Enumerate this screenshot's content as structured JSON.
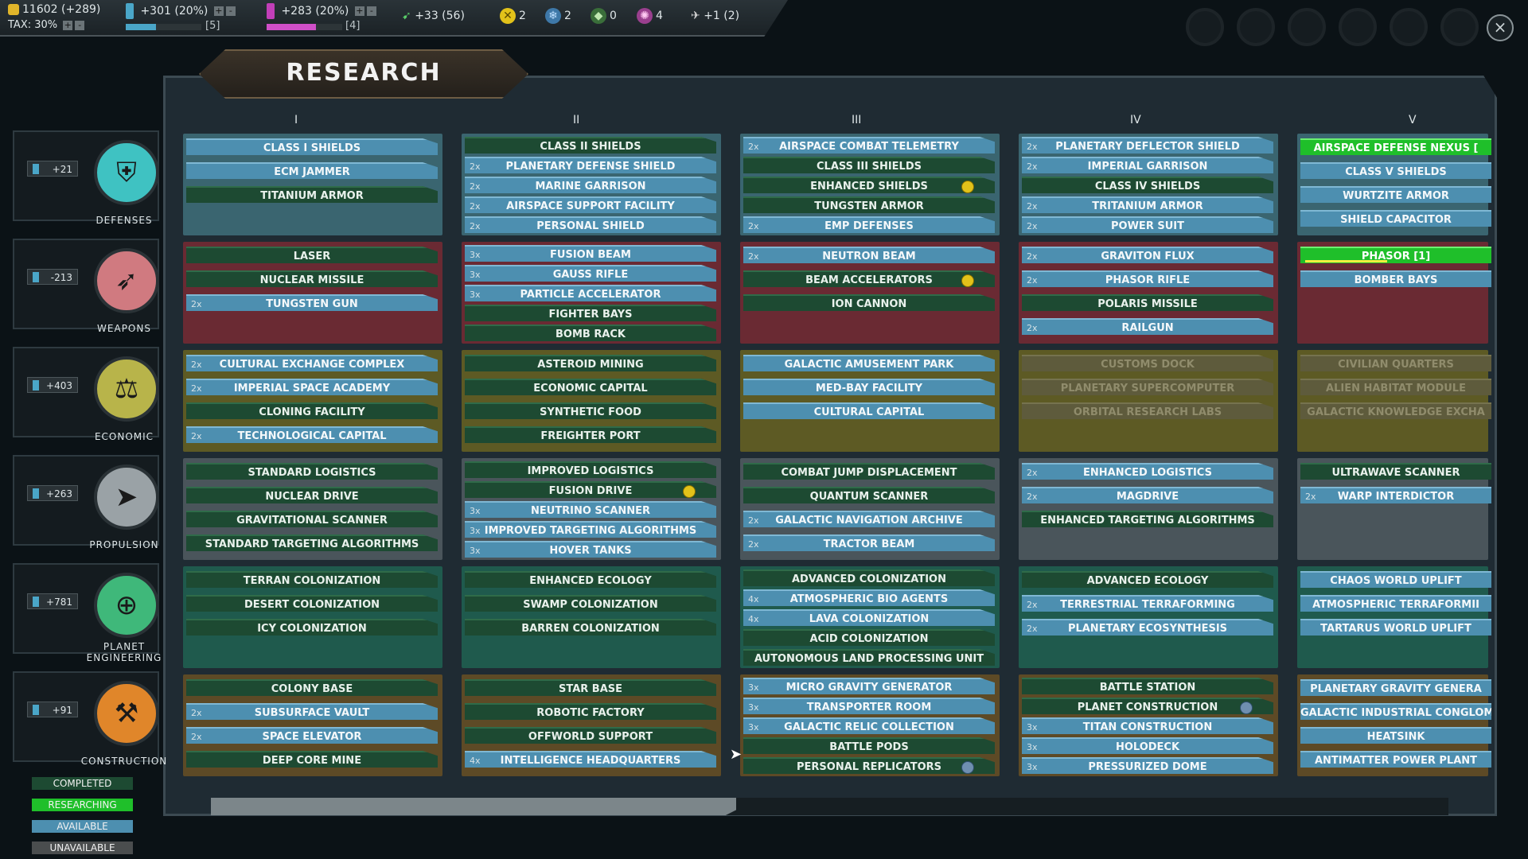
{
  "topbar": {
    "credits": "11602 (+289)",
    "tax": "TAX: 30%",
    "research": "+301 (20%)",
    "research_sub": "[5]",
    "research_fill": 0.4,
    "influence": "+283 (20%)",
    "influence_sub": "[4]",
    "influence_fill": 0.65,
    "ships": "+33 (56)",
    "res_gold": "2",
    "res_blue": "2",
    "res_green": "0",
    "res_pink": "4",
    "cargo": "+1 (2)"
  },
  "title": "RESEARCH",
  "columns": [
    "I",
    "II",
    "III",
    "IV",
    "V"
  ],
  "categories": [
    {
      "label": "DEFENSES",
      "value": "+21",
      "icon": "shield-icon",
      "color": "#3fc2c2"
    },
    {
      "label": "WEAPONS",
      "value": "-213",
      "icon": "missiles-icon",
      "color": "#d07a80"
    },
    {
      "label": "ECONOMIC",
      "value": "+403",
      "icon": "economy-icon",
      "color": "#b8b44a"
    },
    {
      "label": "PROPULSION",
      "value": "+263",
      "icon": "rocket-icon",
      "color": "#9aa2a6"
    },
    {
      "label": "PLANET",
      "label2": "ENGINEERING",
      "value": "+781",
      "icon": "globe-hands-icon",
      "color": "#3fb87a"
    },
    {
      "label": "CONSTRUCTION",
      "value": "+91",
      "icon": "crane-icon",
      "color": "#e0862a"
    }
  ],
  "grid": [
    [
      [
        {
          "n": "CLASS I SHIELDS",
          "s": "available"
        },
        {
          "n": "ECM JAMMER",
          "s": "available"
        },
        {
          "n": "TITANIUM ARMOR",
          "s": "completed"
        }
      ],
      [
        {
          "n": "CLASS II SHIELDS",
          "s": "completed"
        },
        {
          "n": "PLANETARY DEFENSE SHIELD",
          "s": "available",
          "m": "2x"
        },
        {
          "n": "MARINE GARRISON",
          "s": "available",
          "m": "2x"
        },
        {
          "n": "AIRSPACE SUPPORT FACILITY",
          "s": "available",
          "m": "2x"
        },
        {
          "n": "PERSONAL SHIELD",
          "s": "available",
          "m": "2x"
        }
      ],
      [
        {
          "n": "AIRSPACE COMBAT TELEMETRY",
          "s": "available",
          "m": "2x"
        },
        {
          "n": "CLASS III SHIELDS",
          "s": "completed"
        },
        {
          "n": "ENHANCED SHIELDS",
          "s": "completed",
          "b": "gold"
        },
        {
          "n": "TUNGSTEN ARMOR",
          "s": "completed"
        },
        {
          "n": "EMP DEFENSES",
          "s": "available",
          "m": "2x"
        }
      ],
      [
        {
          "n": "PLANETARY DEFLECTOR SHIELD",
          "s": "available",
          "m": "2x"
        },
        {
          "n": "IMPERIAL GARRISON",
          "s": "available",
          "m": "2x"
        },
        {
          "n": "CLASS IV SHIELDS",
          "s": "completed"
        },
        {
          "n": "TRITANIUM ARMOR",
          "s": "available",
          "m": "2x"
        },
        {
          "n": "POWER SUIT",
          "s": "available",
          "m": "2x"
        }
      ],
      [
        {
          "n": "AIRSPACE DEFENSE NEXUS [",
          "s": "researching"
        },
        {
          "n": "CLASS V SHIELDS",
          "s": "available"
        },
        {
          "n": "WURTZITE ARMOR",
          "s": "available"
        },
        {
          "n": "SHIELD CAPACITOR",
          "s": "available"
        }
      ]
    ],
    [
      [
        {
          "n": "LASER",
          "s": "completed"
        },
        {
          "n": "NUCLEAR MISSILE",
          "s": "completed"
        },
        {
          "n": "TUNGSTEN GUN",
          "s": "available",
          "m": "2x"
        }
      ],
      [
        {
          "n": "FUSION BEAM",
          "s": "available",
          "m": "3x"
        },
        {
          "n": "GAUSS RIFLE",
          "s": "available",
          "m": "3x"
        },
        {
          "n": "PARTICLE ACCELERATOR",
          "s": "available",
          "m": "3x"
        },
        {
          "n": "FIGHTER BAYS",
          "s": "completed"
        },
        {
          "n": "BOMB RACK",
          "s": "completed"
        }
      ],
      [
        {
          "n": "NEUTRON BEAM",
          "s": "available",
          "m": "2x"
        },
        {
          "n": "BEAM ACCELERATORS",
          "s": "completed",
          "b": "gold"
        },
        {
          "n": "ION CANNON",
          "s": "completed"
        }
      ],
      [
        {
          "n": "GRAVITON FLUX",
          "s": "available",
          "m": "2x"
        },
        {
          "n": "PHASOR RIFLE",
          "s": "available",
          "m": "2x"
        },
        {
          "n": "POLARIS MISSILE",
          "s": "completed"
        },
        {
          "n": "RAILGUN",
          "s": "available",
          "m": "2x"
        }
      ],
      [
        {
          "n": "PHASOR [1]",
          "s": "researching",
          "p": 0.45
        },
        {
          "n": "BOMBER BAYS",
          "s": "available"
        }
      ]
    ],
    [
      [
        {
          "n": "CULTURAL EXCHANGE COMPLEX",
          "s": "available",
          "m": "2x"
        },
        {
          "n": "IMPERIAL SPACE ACADEMY",
          "s": "available",
          "m": "2x"
        },
        {
          "n": "CLONING FACILITY",
          "s": "completed"
        },
        {
          "n": "TECHNOLOGICAL CAPITAL",
          "s": "available",
          "m": "2x"
        }
      ],
      [
        {
          "n": "ASTEROID MINING",
          "s": "completed"
        },
        {
          "n": "ECONOMIC CAPITAL",
          "s": "completed"
        },
        {
          "n": "SYNTHETIC FOOD",
          "s": "completed"
        },
        {
          "n": "FREIGHTER PORT",
          "s": "completed"
        }
      ],
      [
        {
          "n": "GALACTIC AMUSEMENT PARK",
          "s": "available"
        },
        {
          "n": "MED-BAY FACILITY",
          "s": "available"
        },
        {
          "n": "CULTURAL CAPITAL",
          "s": "available"
        }
      ],
      [
        {
          "n": "CUSTOMS DOCK",
          "s": "unavailable"
        },
        {
          "n": "PLANETARY SUPERCOMPUTER",
          "s": "unavailable"
        },
        {
          "n": "ORBITAL RESEARCH LABS",
          "s": "unavailable"
        }
      ],
      [
        {
          "n": "CIVILIAN QUARTERS",
          "s": "unavailable"
        },
        {
          "n": "ALIEN HABITAT MODULE",
          "s": "unavailable"
        },
        {
          "n": "GALACTIC KNOWLEDGE EXCHA",
          "s": "unavailable"
        }
      ]
    ],
    [
      [
        {
          "n": "STANDARD LOGISTICS",
          "s": "completed"
        },
        {
          "n": "NUCLEAR DRIVE",
          "s": "completed"
        },
        {
          "n": "GRAVITATIONAL SCANNER",
          "s": "completed"
        },
        {
          "n": "STANDARD TARGETING ALGORITHMS",
          "s": "completed"
        }
      ],
      [
        {
          "n": "IMPROVED LOGISTICS",
          "s": "completed"
        },
        {
          "n": "FUSION DRIVE",
          "s": "completed",
          "b": "gold"
        },
        {
          "n": "NEUTRINO SCANNER",
          "s": "available",
          "m": "3x"
        },
        {
          "n": "IMPROVED TARGETING ALGORITHMS",
          "s": "available",
          "m": "3x"
        },
        {
          "n": "HOVER TANKS",
          "s": "available",
          "m": "3x"
        }
      ],
      [
        {
          "n": "COMBAT JUMP DISPLACEMENT",
          "s": "completed"
        },
        {
          "n": "QUANTUM SCANNER",
          "s": "completed"
        },
        {
          "n": "GALACTIC NAVIGATION ARCHIVE",
          "s": "available",
          "m": "2x"
        },
        {
          "n": "TRACTOR BEAM",
          "s": "available",
          "m": "2x"
        }
      ],
      [
        {
          "n": "ENHANCED LOGISTICS",
          "s": "available",
          "m": "2x"
        },
        {
          "n": "MAGDRIVE",
          "s": "available",
          "m": "2x"
        },
        {
          "n": "ENHANCED TARGETING ALGORITHMS",
          "s": "completed"
        }
      ],
      [
        {
          "n": "ULTRAWAVE SCANNER",
          "s": "completed"
        },
        {
          "n": "WARP INTERDICTOR",
          "s": "available",
          "m": "2x"
        }
      ]
    ],
    [
      [
        {
          "n": "TERRAN COLONIZATION",
          "s": "completed"
        },
        {
          "n": "DESERT COLONIZATION",
          "s": "completed"
        },
        {
          "n": "ICY COLONIZATION",
          "s": "completed"
        }
      ],
      [
        {
          "n": "ENHANCED ECOLOGY",
          "s": "completed"
        },
        {
          "n": "SWAMP COLONIZATION",
          "s": "completed"
        },
        {
          "n": "BARREN COLONIZATION",
          "s": "completed"
        }
      ],
      [
        {
          "n": "ADVANCED COLONIZATION",
          "s": "completed"
        },
        {
          "n": "ATMOSPHERIC BIO AGENTS",
          "s": "available",
          "m": "4x"
        },
        {
          "n": "LAVA COLONIZATION",
          "s": "available",
          "m": "4x"
        },
        {
          "n": "ACID COLONIZATION",
          "s": "completed"
        },
        {
          "n": "AUTONOMOUS LAND PROCESSING UNIT",
          "s": "completed"
        }
      ],
      [
        {
          "n": "ADVANCED ECOLOGY",
          "s": "completed"
        },
        {
          "n": "TERRESTRIAL TERRAFORMING",
          "s": "available",
          "m": "2x"
        },
        {
          "n": "PLANETARY ECOSYNTHESIS",
          "s": "available",
          "m": "2x"
        }
      ],
      [
        {
          "n": "CHAOS WORLD UPLIFT",
          "s": "available"
        },
        {
          "n": "ATMOSPHERIC TERRAFORMII",
          "s": "available"
        },
        {
          "n": "TARTARUS WORLD UPLIFT",
          "s": "available"
        }
      ]
    ],
    [
      [
        {
          "n": "COLONY BASE",
          "s": "completed"
        },
        {
          "n": "SUBSURFACE VAULT",
          "s": "available",
          "m": "2x"
        },
        {
          "n": "SPACE ELEVATOR",
          "s": "available",
          "m": "2x"
        },
        {
          "n": "DEEP CORE MINE",
          "s": "completed"
        }
      ],
      [
        {
          "n": "STAR BASE",
          "s": "completed"
        },
        {
          "n": "ROBOTIC FACTORY",
          "s": "completed"
        },
        {
          "n": "OFFWORLD SUPPORT",
          "s": "completed"
        },
        {
          "n": "INTELLIGENCE HEADQUARTERS",
          "s": "available",
          "m": "4x"
        }
      ],
      [
        {
          "n": "MICRO GRAVITY GENERATOR",
          "s": "available",
          "m": "3x"
        },
        {
          "n": "TRANSPORTER ROOM",
          "s": "available",
          "m": "3x"
        },
        {
          "n": "GALACTIC RELIC COLLECTION",
          "s": "available",
          "m": "3x"
        },
        {
          "n": "BATTLE PODS",
          "s": "completed"
        },
        {
          "n": "PERSONAL REPLICATORS",
          "s": "completed",
          "b": "blue"
        }
      ],
      [
        {
          "n": "BATTLE STATION",
          "s": "completed"
        },
        {
          "n": "PLANET CONSTRUCTION",
          "s": "completed",
          "b": "blue"
        },
        {
          "n": "TITAN CONSTRUCTION",
          "s": "available",
          "m": "3x"
        },
        {
          "n": "HOLODECK",
          "s": "available",
          "m": "3x"
        },
        {
          "n": "PRESSURIZED DOME",
          "s": "available",
          "m": "3x"
        }
      ],
      [
        {
          "n": "PLANETARY GRAVITY GENERA",
          "s": "available"
        },
        {
          "n": "GALACTIC INDUSTRIAL CONGLOM",
          "s": "available"
        },
        {
          "n": "HEATSINK",
          "s": "available"
        },
        {
          "n": "ANTIMATTER POWER PLANT",
          "s": "available"
        }
      ]
    ]
  ],
  "legend": [
    {
      "label": "COMPLETED",
      "color": "#1d4a32"
    },
    {
      "label": "RESEARCHING",
      "color": "#1fbf2a"
    },
    {
      "label": "AVAILABLE",
      "color": "#4d8fb0"
    },
    {
      "label": "UNAVAILABLE",
      "color": "#5e5b3c"
    }
  ],
  "close_label": "×"
}
